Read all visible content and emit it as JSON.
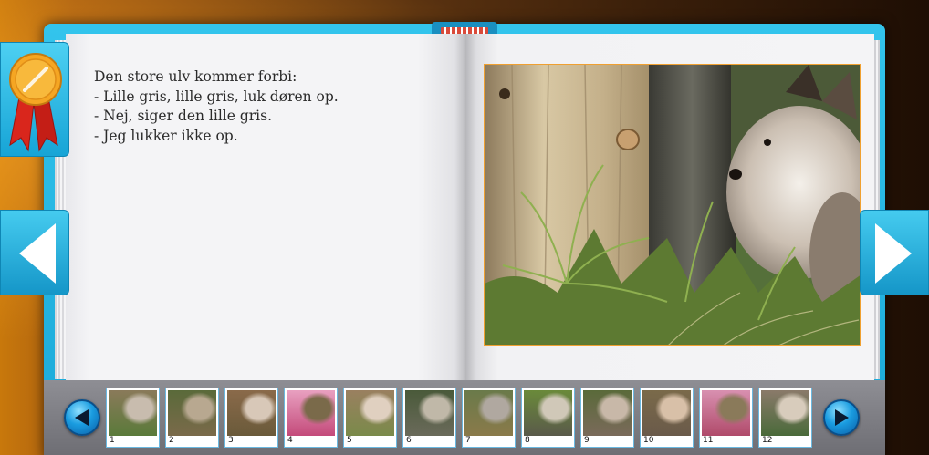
{
  "story": {
    "lines": [
      "Den store ulv kommer forbi:",
      "- Lille gris, lille gris, luk døren op.",
      "- Nej, siger den lille gris.",
      "- Jeg lukker ikke op."
    ]
  },
  "icons": {
    "badge": "award-ribbon-icon",
    "prev_page": "arrow-left-icon",
    "next_page": "arrow-right-icon",
    "strip_prev": "play-left-icon",
    "strip_next": "play-right-icon"
  },
  "thumbnails": [
    "1",
    "2",
    "3",
    "4",
    "5",
    "6",
    "7",
    "8",
    "9",
    "10",
    "11",
    "12"
  ],
  "colors": {
    "frame_blue": "#1aa8d8",
    "photo_border": "#f0a030",
    "badge_gold": "#f5a623",
    "ribbon_red": "#d9261c"
  }
}
